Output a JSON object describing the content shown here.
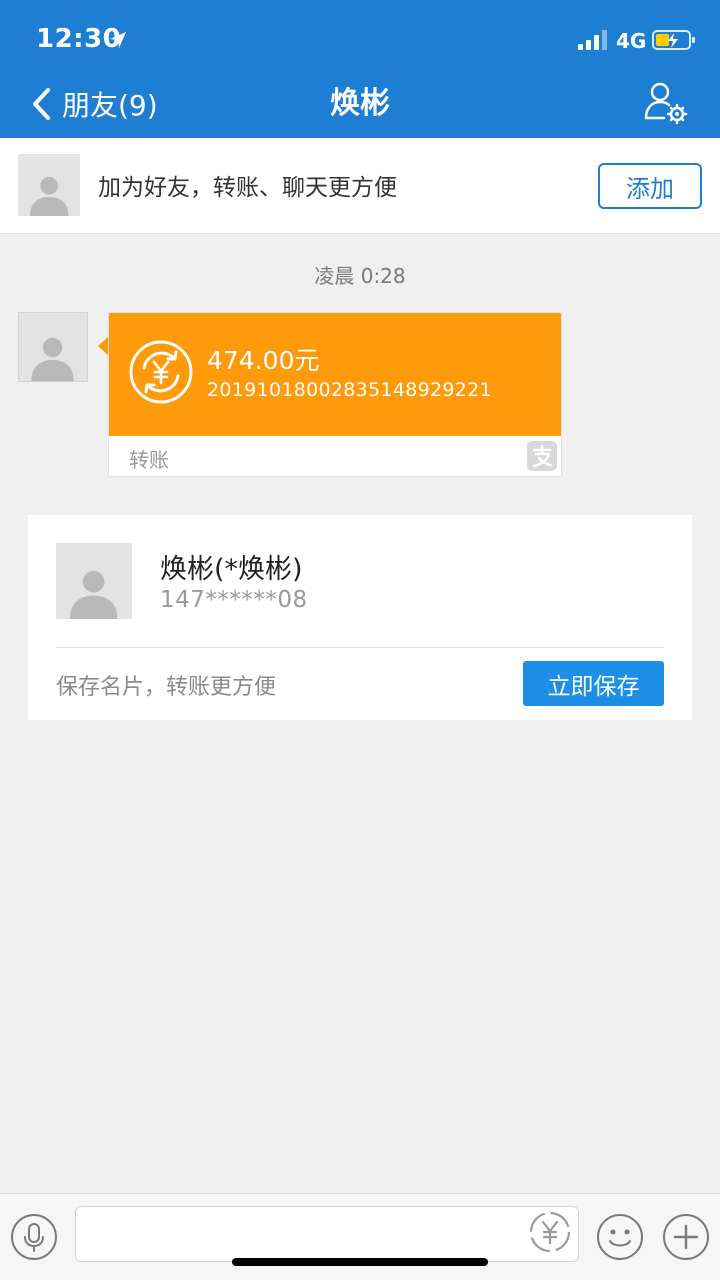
{
  "status_bar": {
    "time": "12:30",
    "network": "4G",
    "icons": [
      "location-arrow-icon",
      "signal-icon",
      "battery-charging-icon"
    ]
  },
  "nav": {
    "back_label": "朋友(9)",
    "title": "焕彬",
    "icons": [
      "chevron-left-icon",
      "user-settings-icon"
    ]
  },
  "friend_banner": {
    "text": "加为好友，转账、聊天更方便",
    "add_button": "添加"
  },
  "chat": {
    "timestamp": "凌晨 0:28",
    "transfer": {
      "amount": "474.00元",
      "id": "20191018002835148929221",
      "label": "转账",
      "icons": [
        "transfer-yuan-icon",
        "alipay-icon"
      ]
    }
  },
  "contact_card": {
    "name": "焕彬(*焕彬)",
    "phone": "147******08",
    "hint": "保存名片，转账更方便",
    "save_button": "立即保存"
  },
  "input_bar": {
    "icons": [
      "microphone-icon",
      "yuan-icon",
      "emoji-icon",
      "plus-icon"
    ]
  },
  "colors": {
    "header_blue": "#1d7ed4",
    "transfer_orange": "#ff9a0b",
    "save_button_blue": "#1d8fe6",
    "background": "#f0f0f0"
  }
}
